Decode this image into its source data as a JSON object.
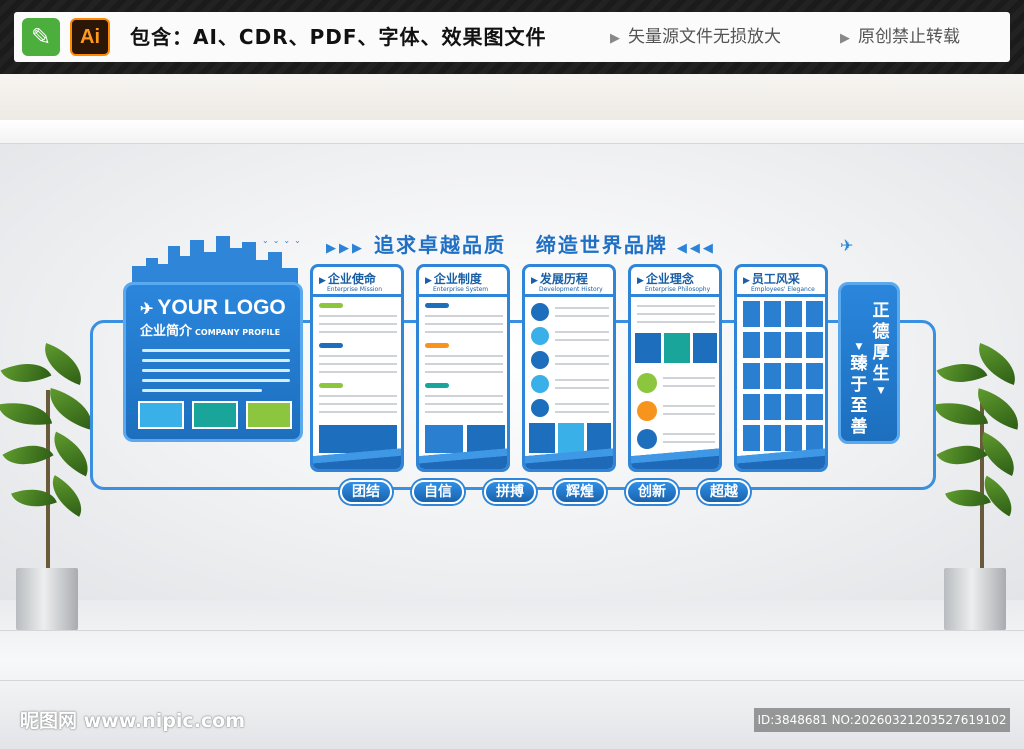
{
  "banner": {
    "pen_icon": "pen-icon",
    "ai_badge": "Ai",
    "contains": "包含：AI、CDR、PDF、字体、效果图文件",
    "feature_1": "矢量源文件无损放大",
    "feature_2": "原创禁止转载"
  },
  "display": {
    "headline_left": "追求卓越品质",
    "headline_right": "缔造世界品牌",
    "logo_text": "YOUR LOGO",
    "profile_cn": "企业简介",
    "profile_en": "COMPANY PROFILE",
    "panels": [
      {
        "title": "企业使命",
        "subtitle": "Enterprise Mission"
      },
      {
        "title": "企业制度",
        "subtitle": "Enterprise System"
      },
      {
        "title": "发展历程",
        "subtitle": "Development History"
      },
      {
        "title": "企业理念",
        "subtitle": "Enterprise Philosophy"
      },
      {
        "title": "员工风采",
        "subtitle": "Employees' Elegance"
      }
    ],
    "motto_left": [
      "臻",
      "于",
      "至",
      "善"
    ],
    "motto_right": [
      "正",
      "德",
      "厚",
      "生"
    ],
    "values": [
      "团结",
      "自信",
      "拼搏",
      "辉煌",
      "创新",
      "超越"
    ],
    "colors": {
      "primary_blue": "#2f86d8",
      "dark_blue": "#1d6fbe",
      "teal": "#1aa59a",
      "green": "#8cc63f",
      "orange": "#f7941d",
      "light_blue": "#3ab0e8"
    }
  },
  "watermark": {
    "site": "昵图网 www.nipic.com",
    "id": "ID:3848681 NO:20260321203527619102"
  }
}
